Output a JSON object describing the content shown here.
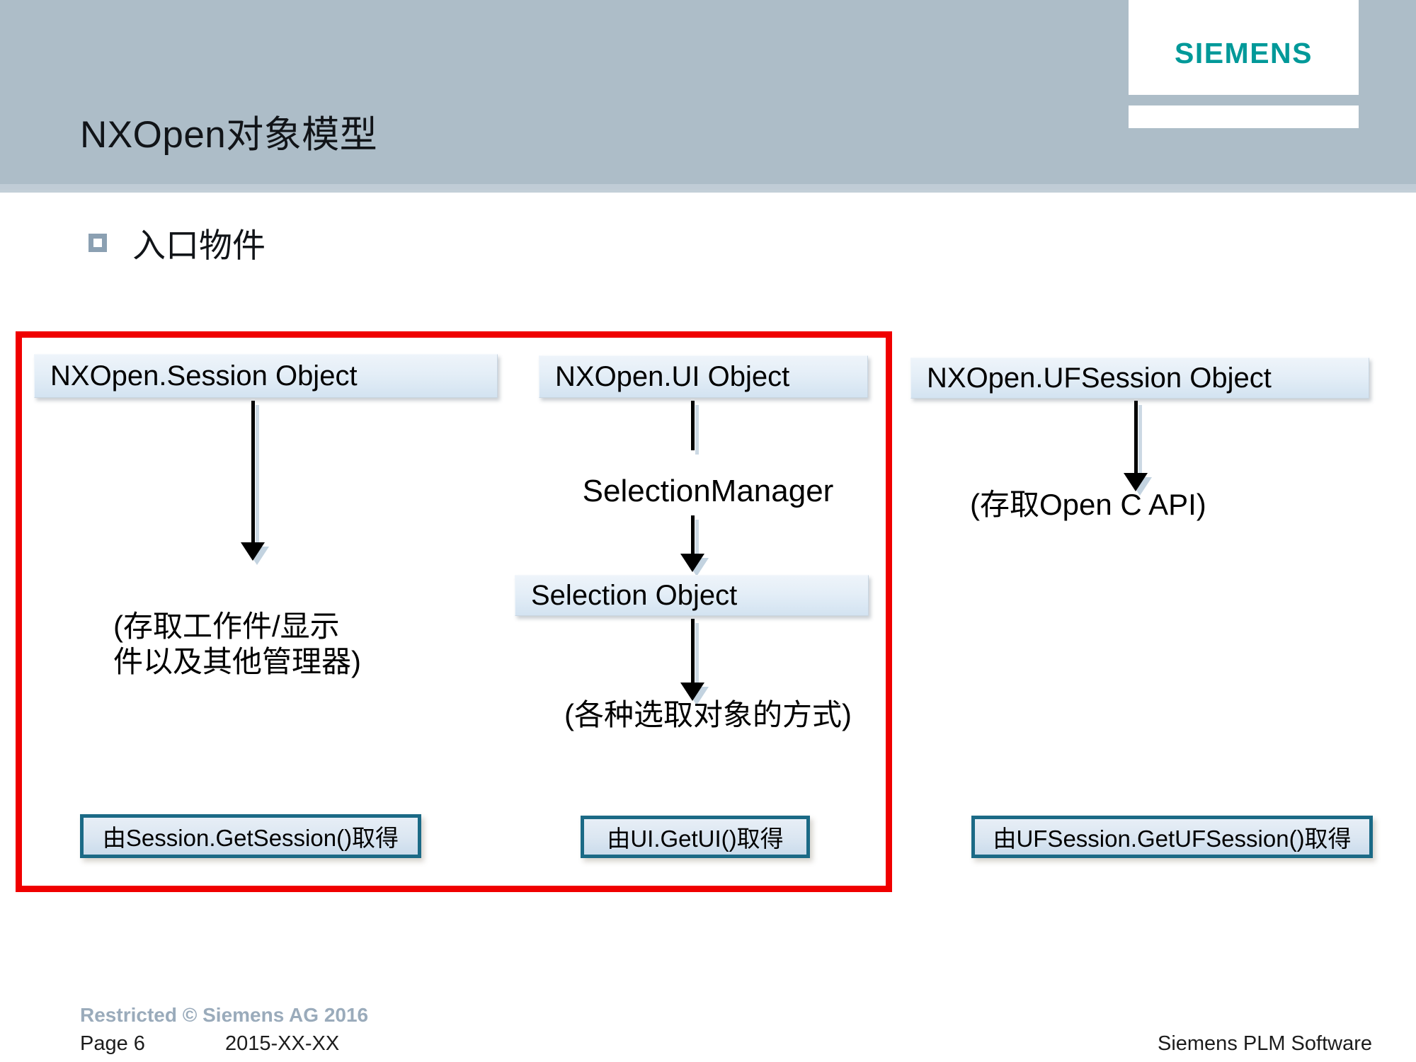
{
  "header": {
    "title": "NXOpen对象模型",
    "logo_text": "SIEMENS",
    "logo_color": "#009999",
    "band_color": "#adbdc8"
  },
  "bullet": {
    "label": "入口物件",
    "marker": "square-outline-bullet"
  },
  "highlight": {
    "color": "#f00000",
    "label": "red-emphasis-frame"
  },
  "diagram": {
    "columns": [
      {
        "id": "session",
        "node": "NXOpen.Session Object",
        "annotation": "(存取工作件/显示\n件以及其他管理器)",
        "getter": "由Session.GetSession()取得"
      },
      {
        "id": "ui",
        "node": "NXOpen.UI Object",
        "mid_label": "SelectionManager",
        "sub_node": "Selection Object",
        "annotation": "(各种选取对象的方式)",
        "getter": "由UI.GetUI()取得"
      },
      {
        "id": "ufsession",
        "node": "NXOpen.UFSession Object",
        "annotation": "(存取Open C API)",
        "getter": "由UFSession.GetUFSession()取得"
      }
    ]
  },
  "footer": {
    "restricted": "Restricted © Siemens AG 2016",
    "page": "Page 6",
    "date": "2015-XX-XX",
    "brand": "Siemens PLM Software"
  }
}
